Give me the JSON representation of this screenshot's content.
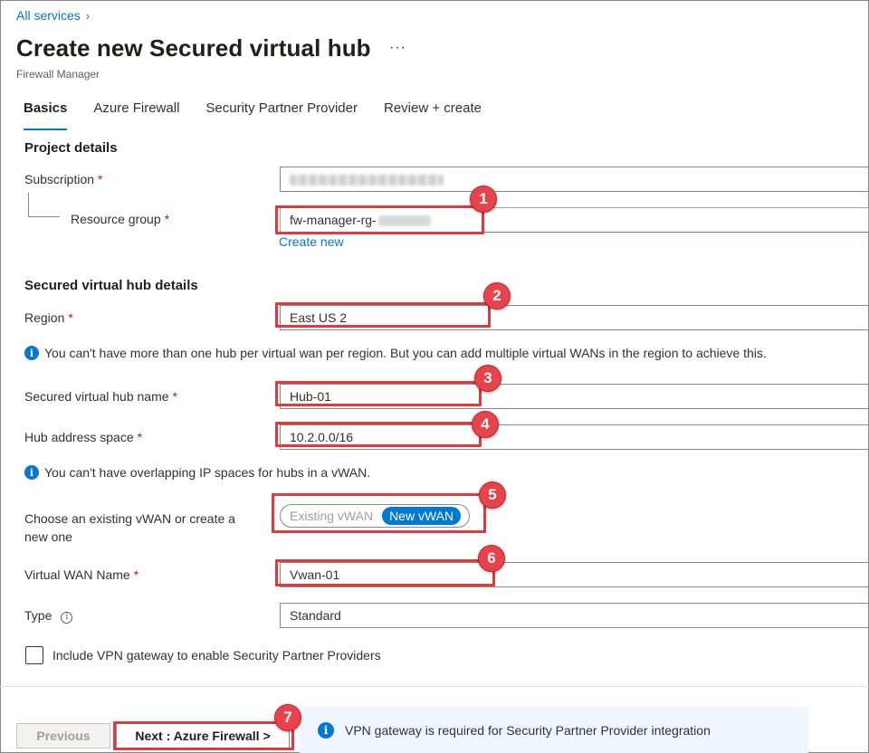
{
  "breadcrumb": {
    "link": "All services",
    "chevron": "›"
  },
  "page": {
    "title": "Create new Secured virtual hub",
    "more": "···",
    "subtitle": "Firewall Manager"
  },
  "tabs": [
    {
      "label": "Basics",
      "active": true
    },
    {
      "label": "Azure Firewall",
      "active": false
    },
    {
      "label": "Security Partner Provider",
      "active": false
    },
    {
      "label": "Review + create",
      "active": false
    }
  ],
  "project": {
    "heading": "Project details",
    "subscription_label": "Subscription",
    "resource_group_label": "Resource group",
    "resource_group_value": "fw-manager-rg-",
    "create_new": "Create new"
  },
  "hub": {
    "heading": "Secured virtual hub details",
    "region_label": "Region",
    "region_value": "East US 2",
    "region_info": "You can't have more than one hub per virtual wan per region. But you can add multiple virtual WANs in the region to achieve this.",
    "name_label": "Secured virtual hub name",
    "name_value": "Hub-01",
    "address_label": "Hub address space",
    "address_value": "10.2.0.0/16",
    "address_info": "You can't have overlapping IP spaces for hubs in a vWAN.",
    "vwan_choice_label": "Choose an existing vWAN or create a new one",
    "vwan_existing": "Existing vWAN",
    "vwan_new": "New vWAN",
    "vwan_name_label": "Virtual WAN Name",
    "vwan_name_value": "Vwan-01",
    "type_label": "Type",
    "type_value": "Standard",
    "vpn_checkbox_label": "Include VPN gateway to enable Security Partner Providers"
  },
  "required_marker": "*",
  "info_glyph": "i",
  "callouts": [
    "1",
    "2",
    "3",
    "4",
    "5",
    "6",
    "7"
  ],
  "footer": {
    "previous": "Previous",
    "next": "Next : Azure Firewall >",
    "notice": "VPN gateway is required for Security Partner Provider integration"
  },
  "colors": {
    "accent": "#0078d4",
    "callout_red": "#e0393e",
    "required": "#a4262c",
    "notice_bg": "#f0f6ff"
  }
}
